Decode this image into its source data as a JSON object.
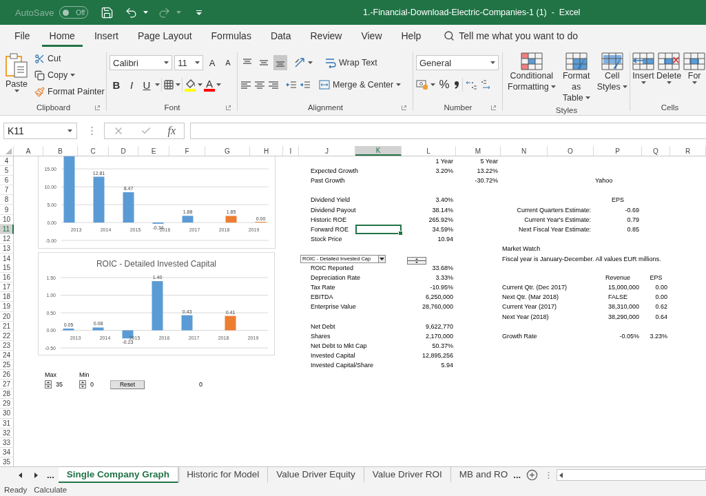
{
  "title_bar": {
    "autosave_label": "AutoSave",
    "autosave_state": "Off",
    "autosave_on": false,
    "title": "1.-Financial-Download-Electric-Companies-1 (1)  -  Excel"
  },
  "menu_tabs": [
    {
      "label": "File",
      "selected": false
    },
    {
      "label": "Home",
      "selected": true
    },
    {
      "label": "Insert",
      "selected": false
    },
    {
      "label": "Page Layout",
      "selected": false
    },
    {
      "label": "Formulas",
      "selected": false
    },
    {
      "label": "Data",
      "selected": false
    },
    {
      "label": "Review",
      "selected": false
    },
    {
      "label": "View",
      "selected": false
    },
    {
      "label": "Help",
      "selected": false
    }
  ],
  "search": {
    "placeholder": "Tell me what you want to do"
  },
  "ribbon": {
    "clipboard": {
      "label": "Clipboard",
      "paste": "Paste",
      "cut": "Cut",
      "copy": "Copy",
      "format_painter": "Format Painter"
    },
    "font": {
      "label": "Font",
      "font_name": "Calibri",
      "font_size": "11",
      "grow": "A",
      "shrink": "A",
      "bold": "B",
      "italic": "I",
      "underline": "U",
      "font_color": "A"
    },
    "alignment": {
      "label": "Alignment",
      "vertical_align": [
        {
          "selected": false
        },
        {
          "selected": false
        },
        {
          "selected": true
        }
      ],
      "wrap_text": "Wrap Text",
      "merge_center": "Merge & Center"
    },
    "number": {
      "label": "Number",
      "format": "General",
      "percent": "%"
    },
    "styles": {
      "label": "Styles",
      "buttons": [
        {
          "kind": "conditional",
          "lines": [
            "Conditional",
            "Formatting"
          ]
        },
        {
          "kind": "table",
          "lines": [
            "Format as",
            "Table"
          ]
        },
        {
          "kind": "cellstyles",
          "lines": [
            "Cell",
            "Styles"
          ]
        }
      ]
    },
    "cells": {
      "label": "Cells",
      "buttons": [
        {
          "kind": "insert",
          "label": "Insert"
        },
        {
          "kind": "delete",
          "label": "Delete"
        },
        {
          "kind": "format",
          "label": "For"
        }
      ]
    }
  },
  "formula_bar": {
    "name_box": "K11",
    "fx": "fx"
  },
  "sheet": {
    "columns": [
      {
        "label": "A",
        "selected": false
      },
      {
        "label": "B",
        "selected": false
      },
      {
        "label": "C",
        "selected": false
      },
      {
        "label": "D",
        "selected": false
      },
      {
        "label": "E",
        "selected": false
      },
      {
        "label": "F",
        "selected": false
      },
      {
        "label": "G",
        "selected": false
      },
      {
        "label": "H",
        "selected": false
      },
      {
        "label": "I",
        "selected": false
      },
      {
        "label": "J",
        "selected": false
      },
      {
        "label": "K",
        "selected": true
      },
      {
        "label": "L",
        "selected": false
      },
      {
        "label": "M",
        "selected": false
      },
      {
        "label": "N",
        "selected": false
      },
      {
        "label": "O",
        "selected": false
      },
      {
        "label": "P",
        "selected": false
      },
      {
        "label": "Q",
        "selected": false
      },
      {
        "label": "R",
        "selected": false
      }
    ],
    "rows": [
      {
        "header": "4",
        "selected": false,
        "cells": {
          "L": {
            "kind": "number",
            "text": "1 Year"
          },
          "M": {
            "kind": "number",
            "text": "5 Year"
          }
        }
      },
      {
        "header": "5",
        "selected": false,
        "cells": {
          "J": {
            "kind": "text",
            "indented": true,
            "text": "Expected Growth"
          },
          "L": {
            "kind": "number",
            "text": "3.20%"
          },
          "M": {
            "kind": "number",
            "text": "13.22%"
          }
        }
      },
      {
        "header": "6",
        "selected": false,
        "cells": {
          "J": {
            "kind": "text",
            "indented": true,
            "text": "Past Growth"
          },
          "M": {
            "kind": "number",
            "text": "-30.72%"
          },
          "P": {
            "kind": "text",
            "text": "Yahoo"
          }
        }
      },
      {
        "header": "7",
        "selected": false
      },
      {
        "header": "8",
        "selected": false,
        "cells": {
          "J": {
            "kind": "text",
            "indented": true,
            "text": "Dividend Yield"
          },
          "L": {
            "kind": "number",
            "text": "3.40%"
          },
          "P": {
            "kind": "centered",
            "text": "EPS"
          }
        }
      },
      {
        "header": "9",
        "selected": false,
        "cells": {
          "J": {
            "kind": "text",
            "indented": true,
            "text": "Dividend Payout"
          },
          "L": {
            "kind": "number",
            "text": "38.14%"
          },
          "O": {
            "kind": "number",
            "text": "Current Quarters Estimate:"
          },
          "P": {
            "kind": "number",
            "text": "-0.69"
          }
        }
      },
      {
        "header": "10",
        "selected": false,
        "cells": {
          "J": {
            "kind": "text",
            "indented": true,
            "text": "Historic ROE"
          },
          "L": {
            "kind": "number",
            "text": "265.92%"
          },
          "O": {
            "kind": "number",
            "text": "Current Year's Estimate:"
          },
          "P": {
            "kind": "number",
            "text": "0.79"
          }
        }
      },
      {
        "header": "11",
        "selected": true,
        "cells": {
          "J": {
            "kind": "text",
            "indented": true,
            "text": "Forward ROE"
          },
          "L": {
            "kind": "number",
            "text": "34.59%"
          },
          "O": {
            "kind": "number",
            "text": "Next Fiscal Year Estimate:"
          },
          "P": {
            "kind": "number",
            "text": "0.85"
          }
        }
      },
      {
        "header": "12",
        "selected": false,
        "cells": {
          "J": {
            "kind": "text",
            "indented": true,
            "text": "Stock Price"
          },
          "L": {
            "kind": "number",
            "text": "10.94"
          }
        }
      },
      {
        "header": "13",
        "selected": false,
        "cells": {
          "N": {
            "kind": "text",
            "text": "Market Watch"
          }
        }
      },
      {
        "header": "14",
        "selected": false,
        "cells": {
          "J": {
            "kind": "dropdown",
            "text": "ROIC - Detailed Invested Cap"
          },
          "L": {
            "kind": "hspinner"
          },
          "N": {
            "kind": "text",
            "text": "Fiscal year is January-December. All values EUR millions."
          }
        }
      },
      {
        "header": "15",
        "selected": false,
        "cells": {
          "J": {
            "kind": "text",
            "indented": true,
            "text": "ROIC Reported"
          },
          "L": {
            "kind": "number",
            "text": "33.68%"
          }
        }
      },
      {
        "header": "16",
        "selected": false,
        "cells": {
          "J": {
            "kind": "text",
            "indented": true,
            "text": "Depreciation Rate"
          },
          "L": {
            "kind": "number",
            "text": "3.33%"
          },
          "P": {
            "kind": "centered",
            "text": "Revenue"
          },
          "Q": {
            "kind": "centered",
            "text": "EPS"
          }
        }
      },
      {
        "header": "17",
        "selected": false,
        "cells": {
          "J": {
            "kind": "text",
            "indented": true,
            "text": "Tax Rate"
          },
          "L": {
            "kind": "number",
            "text": "-10.95%"
          },
          "N": {
            "kind": "text",
            "text": "Current Qtr. (Dec 2017)"
          },
          "P": {
            "kind": "number",
            "text": "15,000,000"
          },
          "Q": {
            "kind": "number",
            "text": "0.00"
          }
        }
      },
      {
        "header": "18",
        "selected": false,
        "cells": {
          "J": {
            "kind": "text",
            "indented": true,
            "text": "EBITDA"
          },
          "L": {
            "kind": "number",
            "text": "6,250,000"
          },
          "N": {
            "kind": "text",
            "text": "Next Qtr. (Mar 2018)"
          },
          "P": {
            "kind": "centered",
            "text": "FALSE"
          },
          "Q": {
            "kind": "number",
            "text": "0.00"
          }
        }
      },
      {
        "header": "19",
        "selected": false,
        "cells": {
          "J": {
            "kind": "text",
            "indented": true,
            "text": "Enterprise Value"
          },
          "L": {
            "kind": "number",
            "text": "28,760,000"
          },
          "N": {
            "kind": "text",
            "text": "Current Year (2017)"
          },
          "P": {
            "kind": "number",
            "text": "38,310,000"
          },
          "Q": {
            "kind": "number",
            "text": "0.62"
          }
        }
      },
      {
        "header": "20",
        "selected": false,
        "cells": {
          "N": {
            "kind": "text",
            "text": "Next Year (2018)"
          },
          "P": {
            "kind": "number",
            "text": "38,290,000"
          },
          "Q": {
            "kind": "number",
            "text": "0.64"
          }
        }
      },
      {
        "header": "21",
        "selected": false,
        "cells": {
          "J": {
            "kind": "text",
            "indented": true,
            "text": "Net Debt"
          },
          "L": {
            "kind": "number",
            "text": "9,622,770"
          }
        }
      },
      {
        "header": "22",
        "selected": false,
        "cells": {
          "J": {
            "kind": "text",
            "indented": true,
            "text": "Shares"
          },
          "L": {
            "kind": "number",
            "text": "2,170,000"
          },
          "N": {
            "kind": "text",
            "text": "Growth Rate"
          },
          "P": {
            "kind": "number",
            "text": "-0.05%"
          },
          "Q": {
            "kind": "number",
            "text": "3.23%"
          }
        }
      },
      {
        "header": "23",
        "selected": false,
        "cells": {
          "J": {
            "kind": "text",
            "indented": true,
            "text": "Net Debt to Mkt Cap"
          },
          "L": {
            "kind": "number",
            "text": "50.37%"
          }
        }
      },
      {
        "header": "24",
        "selected": false,
        "cells": {
          "J": {
            "kind": "text",
            "indented": true,
            "text": "Invested Capital"
          },
          "L": {
            "kind": "number",
            "text": "12,895,256"
          }
        }
      },
      {
        "header": "25",
        "selected": false,
        "cells": {
          "J": {
            "kind": "text",
            "indented": true,
            "text": "Invested Capital/Share"
          },
          "L": {
            "kind": "number",
            "text": "5.94"
          }
        }
      },
      {
        "header": "26",
        "selected": false,
        "cells": {
          "B": {
            "kind": "text",
            "text": "Max"
          },
          "C": {
            "kind": "text",
            "text": "Min"
          }
        }
      },
      {
        "header": "27",
        "selected": false,
        "cells": {
          "B": {
            "kind": "spinner",
            "text": "35"
          },
          "C": {
            "kind": "spinner",
            "text": "0"
          },
          "D": {
            "kind": "button",
            "text": "Reset"
          },
          "F": {
            "kind": "number",
            "text": "0"
          }
        }
      },
      {
        "header": "28",
        "selected": false
      },
      {
        "header": "29",
        "selected": false
      },
      {
        "header": "30",
        "selected": false
      },
      {
        "header": "31",
        "selected": false
      },
      {
        "header": "32",
        "selected": false
      },
      {
        "header": "33",
        "selected": false
      },
      {
        "header": "34",
        "selected": false
      },
      {
        "header": "35",
        "selected": false
      }
    ]
  },
  "charts": [
    {
      "chart_data": {
        "type": "bar",
        "categories": [
          "2013",
          "2014",
          "2015",
          "2016",
          "2017",
          "2018",
          "2019"
        ],
        "series": [
          {
            "color": "#5b9bd5",
            "values": [
              18.5,
              12.81,
              8.47,
              -0.34,
              1.88,
              null,
              null
            ],
            "value_labels": [
              null,
              "12.81",
              "8.47",
              "-0.34",
              "1.88",
              null,
              null
            ]
          },
          {
            "color": "#ed7d31",
            "values": [
              null,
              null,
              null,
              null,
              null,
              1.85,
              0
            ],
            "value_labels": [
              null,
              null,
              null,
              null,
              null,
              "1.85",
              "0.00"
            ]
          }
        ],
        "ylim": [
          -5,
          18.5
        ],
        "yticks": [
          {
            "value": -5,
            "label": "-5.00"
          },
          {
            "value": 0,
            "label": "0.00"
          },
          {
            "value": 5,
            "label": "5.00"
          },
          {
            "value": 10,
            "label": "10.00"
          },
          {
            "value": 15,
            "label": "15.00"
          }
        ],
        "grid": true
      }
    },
    {
      "chart_data": {
        "type": "bar",
        "title": "ROIC - Detailed Invested Capital",
        "categories": [
          "2013",
          "2014",
          "2015",
          "2016",
          "2017",
          "2018",
          "2019"
        ],
        "series": [
          {
            "color": "#5b9bd5",
            "values": [
              0.05,
              0.08,
              -0.23,
              1.4,
              0.43,
              null,
              null
            ],
            "value_labels": [
              "0.05",
              "0.08",
              "-0.23",
              "1.40",
              "0.43",
              null,
              null
            ]
          },
          {
            "color": "#ed7d31",
            "values": [
              null,
              null,
              null,
              null,
              null,
              0.41,
              null
            ],
            "value_labels": [
              null,
              null,
              null,
              null,
              null,
              "0.41",
              null
            ]
          }
        ],
        "ylim": [
          -0.5,
          1.5
        ],
        "yticks": [
          {
            "value": -0.5,
            "label": "-0.50"
          },
          {
            "value": 0,
            "label": "0.00"
          },
          {
            "value": 0.5,
            "label": "0.50"
          },
          {
            "value": 1,
            "label": "1.00"
          },
          {
            "value": 1.5,
            "label": "1.50"
          }
        ],
        "grid": true
      }
    }
  ],
  "sheet_tabs": {
    "more": "...",
    "tabs": [
      {
        "label": "Single Company Graph",
        "selected": true
      },
      {
        "label": "Historic for Model",
        "selected": false
      },
      {
        "label": "Value Driver Equity",
        "selected": false
      },
      {
        "label": "Value Driver ROI",
        "selected": false
      },
      {
        "label": "MB and RO",
        "selected": false
      }
    ],
    "overflow": "..."
  },
  "status_bar": [
    "Ready",
    "Calculate"
  ]
}
